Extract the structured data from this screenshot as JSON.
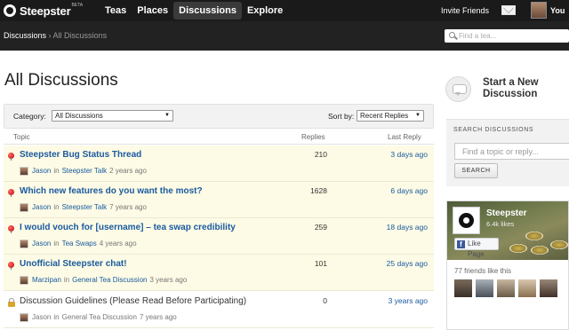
{
  "topbar": {
    "logo_text": "Steepster",
    "logo_badge": "BETA",
    "nav": [
      {
        "label": "Teas",
        "active": false
      },
      {
        "label": "Places",
        "active": false
      },
      {
        "label": "Discussions",
        "active": true
      },
      {
        "label": "Explore",
        "active": false
      }
    ],
    "invite_label": "Invite Friends",
    "user_label": "You"
  },
  "breadcrumb": {
    "root": "Discussions",
    "separator": "›",
    "current": "All Discussions"
  },
  "top_search": {
    "placeholder": "Find a tea..."
  },
  "page": {
    "title": "All Discussions"
  },
  "filters": {
    "category_label": "Category:",
    "category_value": "All Discussions",
    "sort_label": "Sort by:",
    "sort_value": "Recent Replies"
  },
  "table": {
    "headers": {
      "topic": "Topic",
      "replies": "Replies",
      "last_reply": "Last Reply"
    },
    "rows": [
      {
        "title": "Steepster Bug Status Thread",
        "author": "Jason",
        "in_text": "in",
        "forum": "Steepster Talk",
        "age": "2 years ago",
        "replies": "210",
        "last_reply": "3 days ago",
        "icon": "pin-icon"
      },
      {
        "title": "Which new features do you want the most?",
        "author": "Jason",
        "in_text": "in",
        "forum": "Steepster Talk",
        "age": "7 years ago",
        "replies": "1628",
        "last_reply": "6 days ago",
        "icon": "pin-icon"
      },
      {
        "title": "I would vouch for [username] – tea swap credibility",
        "author": "Jason",
        "in_text": "in",
        "forum": "Tea Swaps",
        "age": "4 years ago",
        "replies": "259",
        "last_reply": "18 days ago",
        "icon": "pin-icon"
      },
      {
        "title": "Unofficial Steepster chat!",
        "author": "Marzipan",
        "in_text": "in",
        "forum": "General Tea Discussion",
        "age": "3 years ago",
        "replies": "101",
        "last_reply": "25 days ago",
        "icon": "pin-icon"
      },
      {
        "title": "Discussion Guidelines (Please Read Before Participating)",
        "author": "Jason",
        "in_text": "in",
        "forum": "General Tea Discussion",
        "age": "7 years ago",
        "replies": "0",
        "last_reply": "3 years ago",
        "icon": "lock-icon"
      }
    ]
  },
  "sidebar": {
    "new_discussion": "Start a New Discussion",
    "search_title": "SEARCH DISCUSSIONS",
    "search_placeholder": "Find a topic or reply...",
    "search_button": "SEARCH",
    "facebook": {
      "page_name": "Steepster",
      "likes": "6.4k likes",
      "like_button": "Like Page",
      "fb_glyph": "f",
      "friends_text": "77 friends like this"
    }
  },
  "colors": {
    "link": "#1a5aa0",
    "row_bg": "#fdfbe5",
    "topbar": "#1a1a1a",
    "facebook": "#3b5998"
  }
}
